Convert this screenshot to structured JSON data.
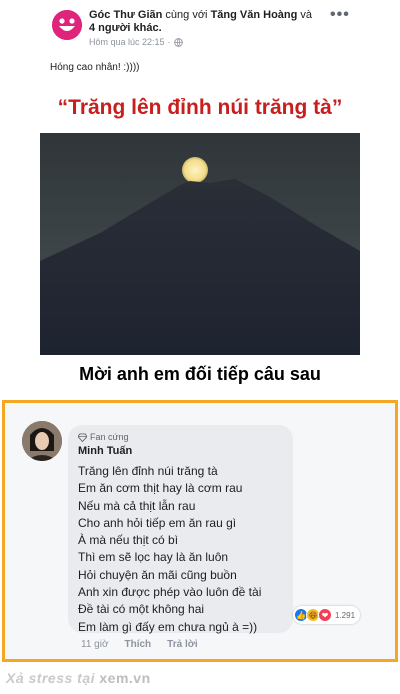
{
  "post": {
    "author": "Góc Thư Giãn",
    "with_word": "cùng với",
    "tagged": "Tăng Văn Hoàng",
    "and_word": "và",
    "others": "4 người khác.",
    "time": "Hôm qua lúc 22:15",
    "separator": "·",
    "more": "•••",
    "text": "Hóng cao nhân! :))))"
  },
  "meme": {
    "title": "“Trăng lên đỉnh núi trăng tà”",
    "bottom_text": "Mời anh em đối tiếp câu sau"
  },
  "comment": {
    "badge": "Fan cứng",
    "author": "Minh Tuấn",
    "lines": [
      "Trăng lên đỉnh núi trăng tà",
      "Em ăn cơm thịt hay là cơm rau",
      "Nếu mà cả thịt lẫn rau",
      "Cho anh hỏi tiếp em ăn rau gì",
      "À mà nếu thịt có bì",
      "Thì em sẽ lọc hay là ăn luôn",
      "Hỏi chuyện ăn mãi cũng buồn",
      "Anh xin được phép vào luôn đề tài",
      "Đề tài có một không hai",
      "Em làm gì đấy em chưa ngủ à =))"
    ],
    "reaction_count": "1.291",
    "time": "11 giờ",
    "like_label": "Thích",
    "reply_label": "Trả lời"
  },
  "watermark": {
    "prefix": "Xả stress tại",
    "brand": "xem.vn"
  },
  "colors": {
    "frame": "#f5a623",
    "title_red": "#c81e1e",
    "page_avatar": "#e0237b",
    "like_blue": "#1877f2"
  }
}
